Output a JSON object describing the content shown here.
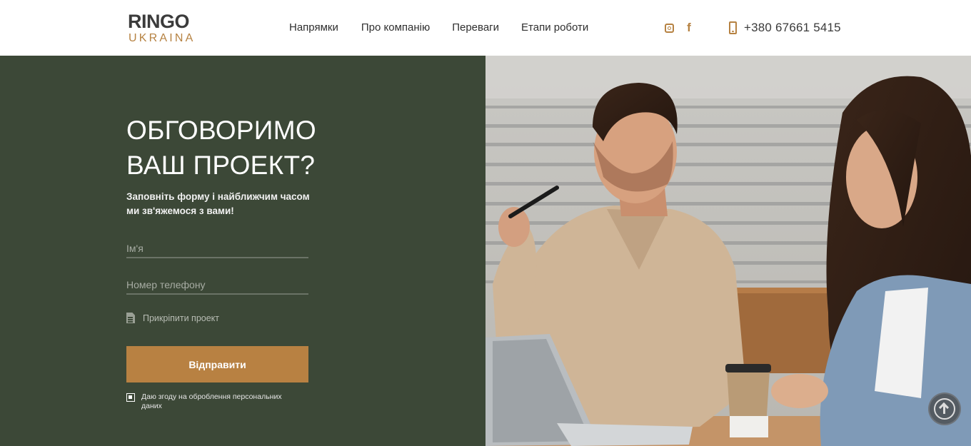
{
  "header": {
    "logo": {
      "top": "RINGO",
      "bottom": "UKRAINA"
    },
    "nav": [
      {
        "label": "Напрямки"
      },
      {
        "label": "Про компанію"
      },
      {
        "label": "Переваги"
      },
      {
        "label": "Етапи роботи"
      }
    ],
    "social": [
      {
        "icon": "instagram-icon"
      },
      {
        "icon": "facebook-icon",
        "glyph": "f"
      }
    ],
    "phone": "+380 67661 5415"
  },
  "hero": {
    "title_line1": "ОБГОВОРИМО",
    "title_line2": "ВАШ ПРОЕКТ?",
    "subtitle_line1": "Заповніть форму і найближчим часом",
    "subtitle_line2": "ми зв'яжемося з вами!"
  },
  "form": {
    "name_placeholder": "Ім'я",
    "phone_placeholder": "Номер телефону",
    "attach_label": "Прикріпити проект",
    "submit_label": "Відправити",
    "consent_label": "Даю згоду на оброблення персональних даних",
    "consent_checked": true
  },
  "colors": {
    "accent": "#b88142",
    "panel": "#3c4837",
    "header_bg": "#ffffff"
  }
}
